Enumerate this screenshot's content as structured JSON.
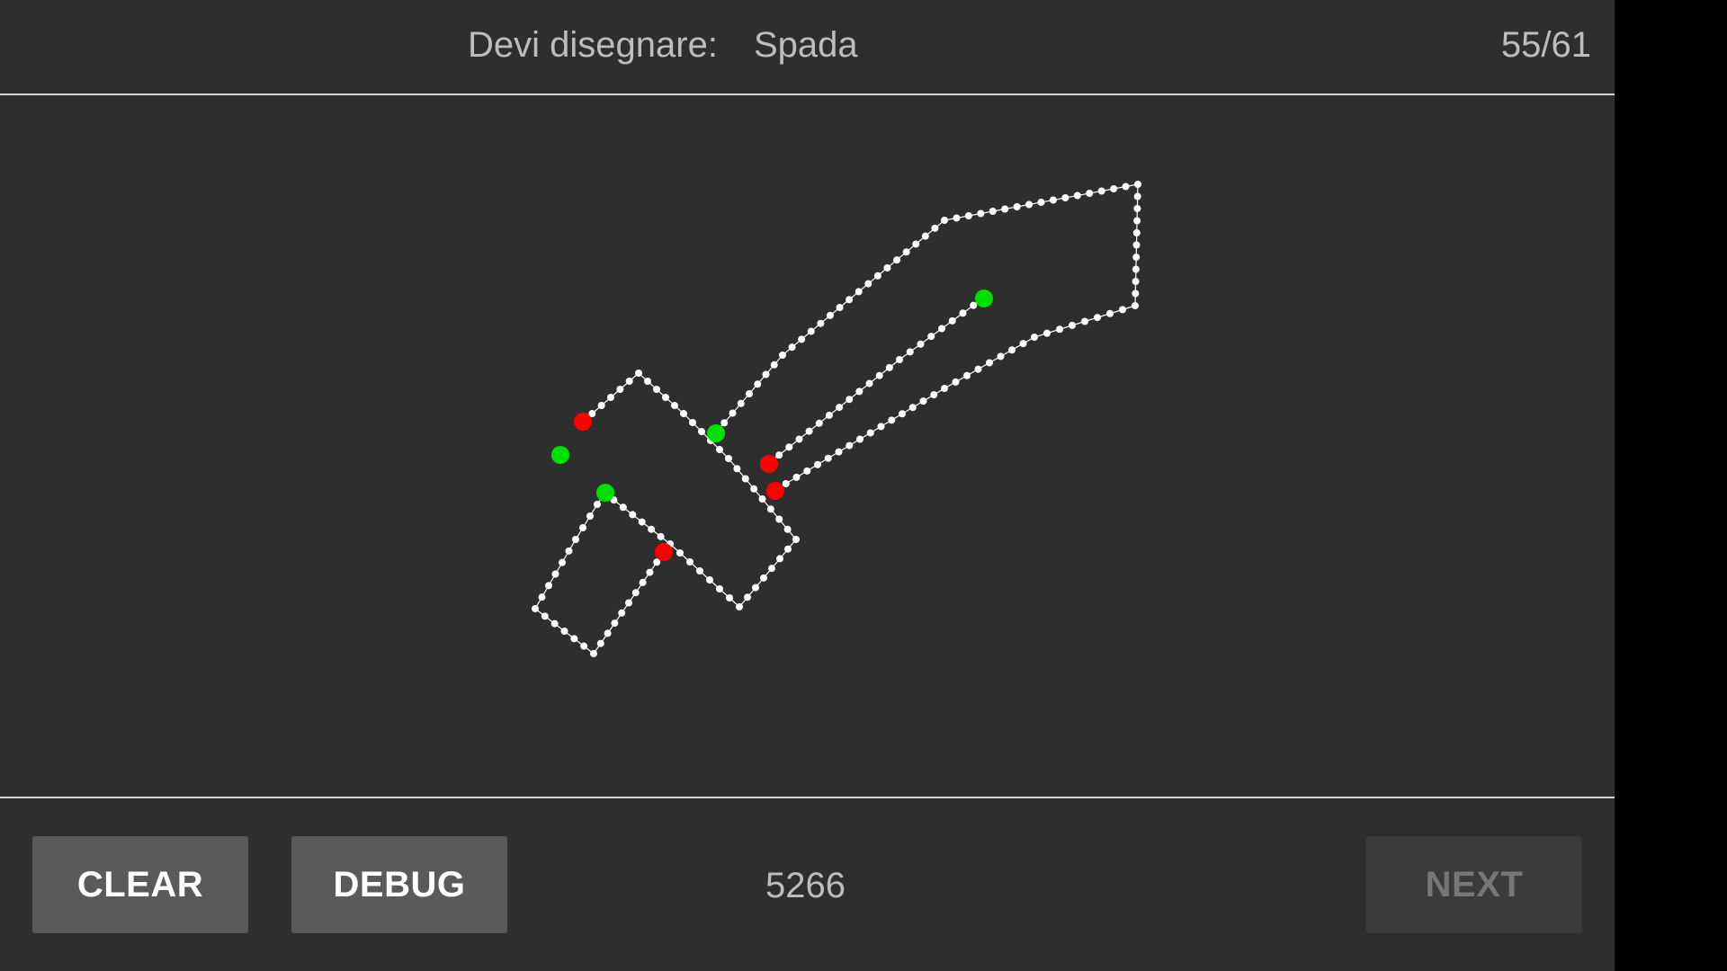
{
  "header": {
    "prompt_label": "Devi disegnare:",
    "prompt_word": "Spada",
    "progress": "55/61"
  },
  "footer": {
    "clear_label": "CLEAR",
    "debug_label": "DEBUG",
    "score": "5266",
    "next_label": "NEXT",
    "next_enabled": false
  },
  "colors": {
    "background": "#2e2e2e",
    "stroke": "#ffffff",
    "stroke_start": "#00e000",
    "stroke_end": "#ff0000",
    "button": "#5a5a5b",
    "button_disabled": "#3b3b3c"
  }
}
